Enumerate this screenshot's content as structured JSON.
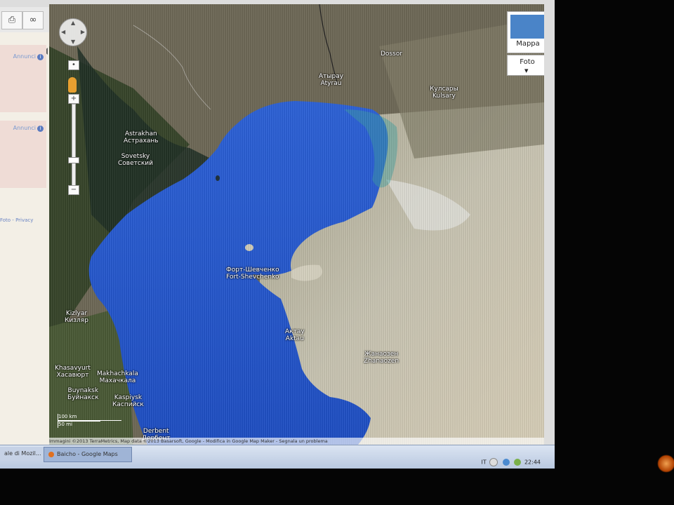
{
  "sidebar": {
    "ads": [
      {
        "label": "Annunci"
      },
      {
        "label": "Annunci"
      }
    ],
    "info_glyph": "i",
    "footer_link": "Foto - Privacy"
  },
  "toolbar": {
    "print_icon": "printer-icon",
    "link_icon": "link-icon"
  },
  "map": {
    "layer_buttons": {
      "map_label": "Mappa",
      "photo_label": "Foto"
    },
    "places": [
      {
        "name": "Dossor"
      },
      {
        "name": "Атырау",
        "latin": "Atyrau"
      },
      {
        "name": "Кулсары",
        "latin": "Kulsary"
      },
      {
        "name": "Astrakhan",
        "latin": "Астрахань"
      },
      {
        "name": "Sovetsky",
        "latin": "Советский"
      },
      {
        "name": "Форт-Шевченко",
        "latin": "Fort-Shevchenko"
      },
      {
        "name": "Актау",
        "latin": "Aktau"
      },
      {
        "name": "Жанаозен",
        "latin": "Zhanaozen"
      },
      {
        "name": "Kizlyar",
        "latin": "Кизляр"
      },
      {
        "name": "Khasavyurt",
        "latin": "Хасавюрт"
      },
      {
        "name": "Makhachkala",
        "latin": "Махачкала"
      },
      {
        "name": "Buynaksk",
        "latin": "Буйнакск"
      },
      {
        "name": "Kaspiysk",
        "latin": "Каспийск"
      },
      {
        "name": "Derbent",
        "latin": "Дербент"
      }
    ],
    "scale": {
      "km": "100 km",
      "mi": "50 mi"
    },
    "attribution": "Immagini ©2013 TerraMetrics, Map data ©2013 Basarsoft, Google - Modifica in Google Map Maker - Segnala un problema"
  },
  "taskbar": {
    "items": [
      {
        "label": "ale di Mozil..."
      },
      {
        "label": "Baicho - Google Maps"
      }
    ],
    "lang": "IT",
    "clock": "22:44"
  },
  "colors": {
    "sea": "#2a63d6",
    "land_west": "#3e4a2c",
    "land_east": "#cfcab8"
  }
}
